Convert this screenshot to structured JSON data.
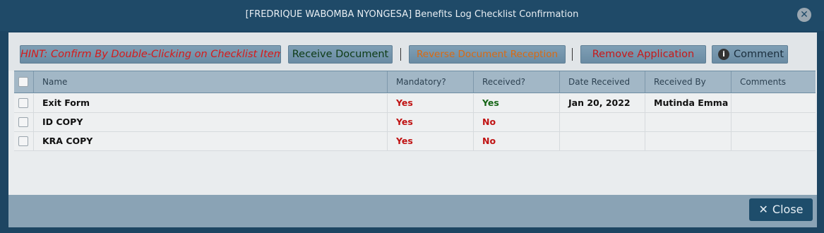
{
  "dialog": {
    "title": "[FREDRIQUE WABOMBA NYONGESA] Benefits Log Checklist Confirmation",
    "close_glyph": "✕"
  },
  "toolbar": {
    "hint_label": "HINT: Confirm By Double-Clicking on Checklist Item",
    "receive_label": "Receive Document",
    "reverse_label": "Reverse Document Reception",
    "remove_label": "Remove Application",
    "comment_label": "Comment",
    "comment_icon": "info-icon"
  },
  "grid": {
    "columns": [
      "Name",
      "Mandatory?",
      "Received?",
      "Date Received",
      "Received By",
      "Comments"
    ],
    "rows": [
      {
        "name": "Exit Form",
        "mandatory": "Yes",
        "received": "Yes",
        "date_received": "Jan 20, 2022",
        "received_by": "Mutinda Emma",
        "comments": ""
      },
      {
        "name": "ID COPY",
        "mandatory": "Yes",
        "received": "No",
        "date_received": "",
        "received_by": "",
        "comments": ""
      },
      {
        "name": "KRA COPY",
        "mandatory": "Yes",
        "received": "No",
        "date_received": "",
        "received_by": "",
        "comments": ""
      }
    ]
  },
  "footer": {
    "close_label": "Close",
    "close_icon": "close-icon"
  },
  "colors": {
    "title_bar": "#1f4a68",
    "hint_text": "#d51a1a",
    "yes_received": "#176617",
    "no_received": "#c01313",
    "reverse_text": "#d96a12"
  }
}
